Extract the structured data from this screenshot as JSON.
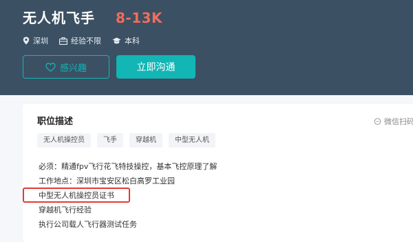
{
  "job": {
    "title": "无人机飞手",
    "salary": "8-13K",
    "location": "深圳",
    "experience": "经验不限",
    "education": "本科"
  },
  "actions": {
    "interest_label": "感兴趣",
    "chat_label": "立即沟通"
  },
  "description": {
    "section_title": "职位描述",
    "wechat_label": "微信扫码",
    "tags": [
      "无人机操控员",
      "飞手",
      "穿越机",
      "中型无人机"
    ],
    "lines": [
      "必须：精通fpv飞行花飞特技操控，基本飞控原理了解",
      "工作地点：深圳市宝安区松白高罗工业园",
      "中型无人机操控员证书",
      "穿越机飞行经验",
      "执行公司载人飞行器测试任务"
    ]
  },
  "colors": {
    "header_bg": "#3b5063",
    "accent": "#12b6b5",
    "salary": "#f26d5b",
    "highlight": "#e53935"
  },
  "icons": {
    "location": "location-pin-icon",
    "experience": "briefcase-icon",
    "education": "graduation-cap-icon",
    "interest": "heart-icon",
    "wechat": "chat-bubble-icon"
  }
}
